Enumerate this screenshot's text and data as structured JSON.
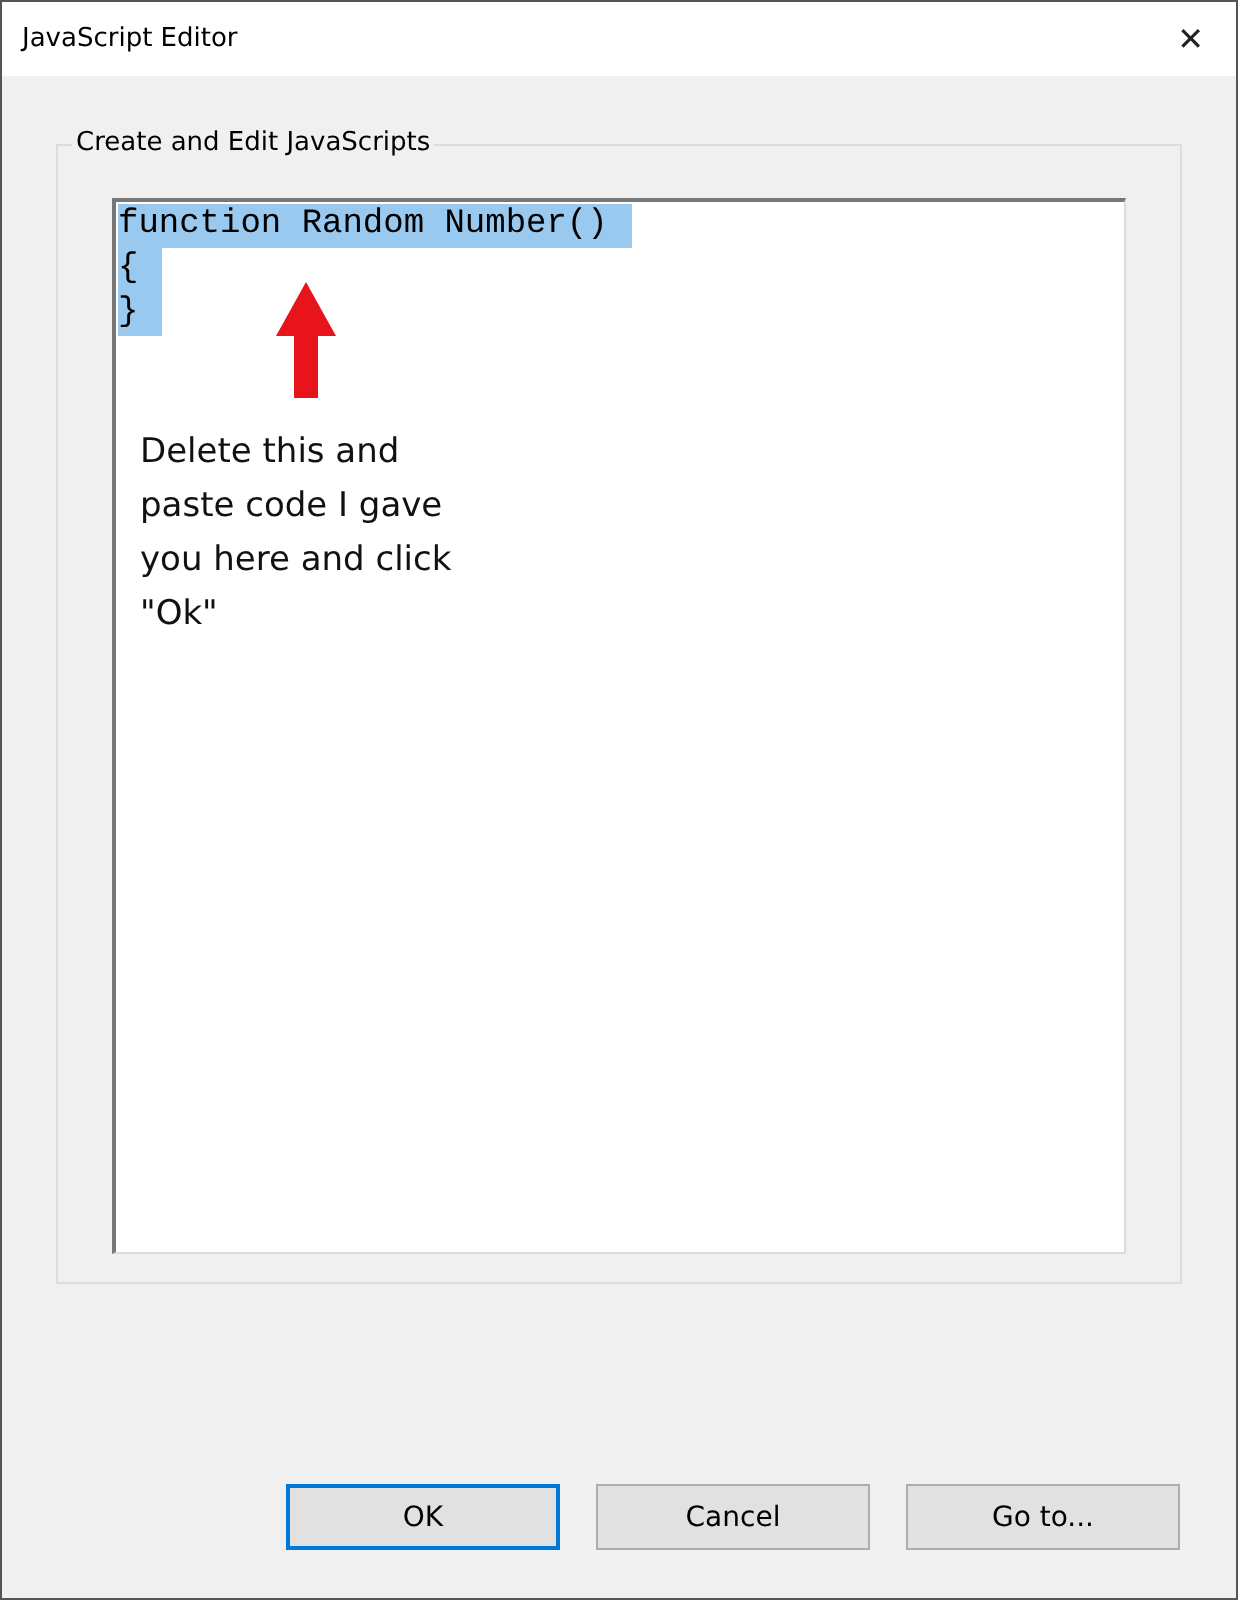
{
  "window": {
    "title": "JavaScript Editor",
    "close": "✕"
  },
  "group": {
    "label": "Create and Edit JavaScripts"
  },
  "editor": {
    "lines": [
      {
        "text": "function Random Number()",
        "selected": true
      },
      {
        "text": "{",
        "selected": true
      },
      {
        "text": "}",
        "selected": true
      }
    ]
  },
  "annotation": {
    "text": "Delete this and paste code I gave you here and click \"Ok\""
  },
  "buttons": [
    {
      "label": "OK",
      "default": true
    },
    {
      "label": "Cancel",
      "default": false
    },
    {
      "label": "Go to...",
      "default": false
    }
  ]
}
